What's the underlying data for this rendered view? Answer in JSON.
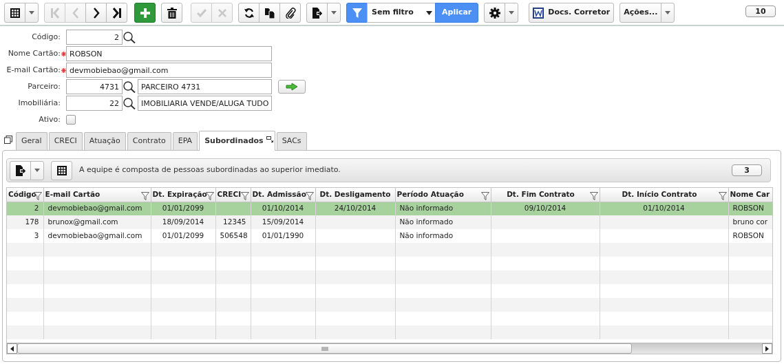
{
  "toolbar": [
    {
      "buttons": [
        {
          "kind": "grid",
          "disabled": false
        },
        {
          "kind": "caret",
          "disabled": false
        }
      ]
    },
    {
      "buttons": [
        {
          "kind": "first",
          "disabled": true
        },
        {
          "kind": "prev",
          "disabled": true
        },
        {
          "kind": "next",
          "disabled": false
        },
        {
          "kind": "last",
          "disabled": false
        }
      ]
    },
    {
      "buttons": [
        {
          "kind": "add",
          "disabled": false
        }
      ]
    },
    {
      "buttons": [
        {
          "kind": "delete",
          "disabled": false
        }
      ]
    },
    {
      "buttons": [
        {
          "kind": "confirm",
          "disabled": true
        },
        {
          "kind": "cancel",
          "disabled": true
        }
      ]
    },
    {
      "buttons": [
        {
          "kind": "refresh",
          "disabled": false
        },
        {
          "kind": "copy",
          "disabled": false
        },
        {
          "kind": "attach",
          "disabled": false
        }
      ]
    },
    {
      "buttons": [
        {
          "kind": "export",
          "disabled": false
        },
        {
          "kind": "caret",
          "disabled": false
        }
      ]
    },
    {
      "buttons": [
        {
          "kind": "filter",
          "disabled": false
        },
        {
          "kind": "select",
          "label": "Sem filtro",
          "disabled": false
        },
        {
          "kind": "apply",
          "label": "Aplicar",
          "disabled": false
        }
      ]
    },
    {
      "buttons": [
        {
          "kind": "gear",
          "disabled": false
        },
        {
          "kind": "caret",
          "disabled": false
        }
      ]
    },
    {
      "buttons": [
        {
          "kind": "docs",
          "label": "Docs. Corretor",
          "disabled": false
        }
      ]
    },
    {
      "buttons": [
        {
          "kind": "text",
          "label": "Ações...",
          "disabled": false
        },
        {
          "kind": "caret",
          "disabled": false
        }
      ]
    }
  ],
  "record_count": "10",
  "form": [
    {
      "label": "Código:",
      "required": false,
      "kind": "code",
      "value": "2"
    },
    {
      "label": "Nome Cartão:",
      "required": true,
      "kind": "text",
      "value": "ROBSON"
    },
    {
      "label": "E-mail Cartão:",
      "required": true,
      "kind": "text",
      "value": "devmobiebao@gmail.com"
    },
    {
      "label": "Parceiro:",
      "required": false,
      "kind": "lookup",
      "value": "4731",
      "description": "PARCEIRO 4731",
      "go_button": true
    },
    {
      "label": "Imobiliária:",
      "required": false,
      "kind": "lookup",
      "value": "22",
      "description": "IMOBILIARIA VENDE/ALUGA TUDO",
      "go_button": false
    },
    {
      "label": "Ativo:",
      "required": false,
      "kind": "checkbox",
      "checked": false
    }
  ],
  "tabs": [
    {
      "label": "Geral",
      "selected": false
    },
    {
      "label": "CRECI",
      "selected": false
    },
    {
      "label": "Atuação",
      "selected": false
    },
    {
      "label": "Contrato",
      "selected": false
    },
    {
      "label": "EPA",
      "selected": false
    },
    {
      "label": "Subordinados",
      "selected": true
    },
    {
      "label": "SACs",
      "selected": false
    }
  ],
  "panel": {
    "description": "A equipe é composta de pessoas subordinadas ao superior imediato.",
    "record_count": "3"
  },
  "table": {
    "columns": [
      {
        "label": "Código",
        "filter": true
      },
      {
        "label": "E-mail Cartão",
        "filter": true
      },
      {
        "label": "Dt. Expiração",
        "filter": true
      },
      {
        "label": "CRECI",
        "filter": true
      },
      {
        "label": "Dt. Admissão",
        "filter": true
      },
      {
        "label": "Dt. Desligamento",
        "filter": false
      },
      {
        "label": "Período Atuação",
        "filter": true
      },
      {
        "label": "Dt. Fim Contrato",
        "filter": true
      },
      {
        "label": "Dt. Início Contrato",
        "filter": true
      },
      {
        "label": "Nome Car",
        "filter": false
      }
    ],
    "rows": [
      {
        "selected": true,
        "cells": [
          "2",
          "devmobiebao@gmail.com",
          "01/01/2099",
          "",
          "01/10/2014",
          "24/10/2014",
          "Não informado",
          "09/10/2014",
          "01/10/2014",
          "ROBSON"
        ]
      },
      {
        "selected": false,
        "cells": [
          "178",
          "brunox@gmail.com",
          "18/09/2014",
          "12345",
          "15/09/2014",
          "",
          "Não informado",
          "",
          "",
          "bruno cor"
        ]
      },
      {
        "selected": false,
        "cells": [
          "3",
          "devmobiebao@gmail.com",
          "01/01/2099",
          "506548",
          "01/01/1990",
          "",
          "Não informado",
          "",
          "",
          "ROBSON"
        ]
      }
    ]
  }
}
